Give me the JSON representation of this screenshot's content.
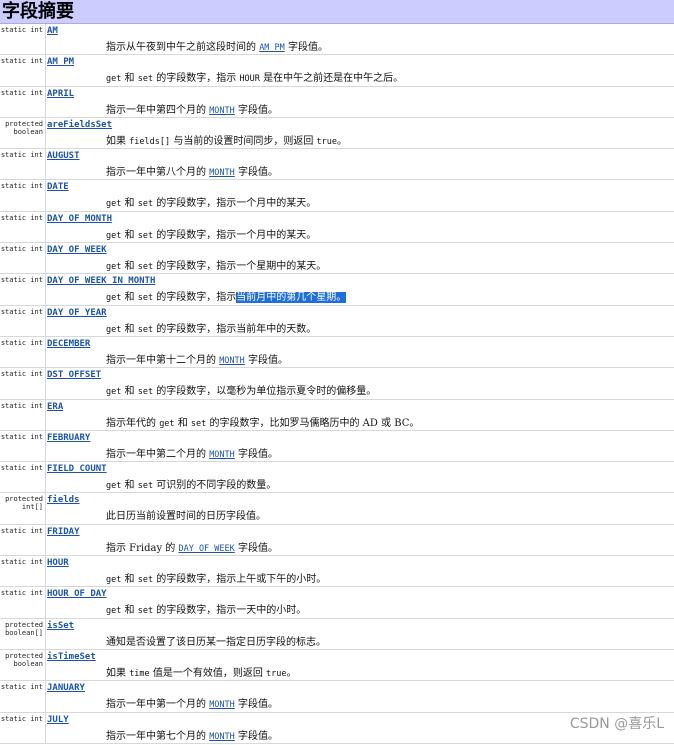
{
  "header": {
    "title": "字段摘要"
  },
  "rows": [
    {
      "modifier": "static int",
      "name": "AM",
      "parts": [
        {
          "t": "text",
          "v": "指示从午夜到中午之前这段时间的 "
        },
        {
          "t": "link",
          "v": "AM_PM"
        },
        {
          "t": "text",
          "v": " 字段值。"
        }
      ]
    },
    {
      "modifier": "static int",
      "name": "AM_PM",
      "parts": [
        {
          "t": "code",
          "v": "get"
        },
        {
          "t": "text",
          "v": " 和 "
        },
        {
          "t": "code",
          "v": "set"
        },
        {
          "t": "text",
          "v": " 的字段数字，指示 "
        },
        {
          "t": "code",
          "v": "HOUR"
        },
        {
          "t": "text",
          "v": " 是在中午之前还是在中午之后。"
        }
      ]
    },
    {
      "modifier": "static int",
      "name": "APRIL",
      "parts": [
        {
          "t": "text",
          "v": "指示一年中第四个月的 "
        },
        {
          "t": "link",
          "v": "MONTH"
        },
        {
          "t": "text",
          "v": " 字段值。"
        }
      ]
    },
    {
      "modifier": "protected\nboolean",
      "name": "areFieldsSet",
      "parts": [
        {
          "t": "text",
          "v": "如果 "
        },
        {
          "t": "code",
          "v": "fields[]"
        },
        {
          "t": "text",
          "v": " 与当前的设置时间同步，则返回 "
        },
        {
          "t": "code",
          "v": "true"
        },
        {
          "t": "text",
          "v": "。"
        }
      ]
    },
    {
      "modifier": "static int",
      "name": "AUGUST",
      "parts": [
        {
          "t": "text",
          "v": "指示一年中第八个月的 "
        },
        {
          "t": "link",
          "v": "MONTH"
        },
        {
          "t": "text",
          "v": " 字段值。"
        }
      ]
    },
    {
      "modifier": "static int",
      "name": "DATE",
      "parts": [
        {
          "t": "code",
          "v": "get"
        },
        {
          "t": "text",
          "v": " 和 "
        },
        {
          "t": "code",
          "v": "set"
        },
        {
          "t": "text",
          "v": " 的字段数字，指示一个月中的某天。"
        }
      ]
    },
    {
      "modifier": "static int",
      "name": "DAY_OF_MONTH",
      "parts": [
        {
          "t": "code",
          "v": "get"
        },
        {
          "t": "text",
          "v": " 和 "
        },
        {
          "t": "code",
          "v": "set"
        },
        {
          "t": "text",
          "v": " 的字段数字，指示一个月中的某天。"
        }
      ]
    },
    {
      "modifier": "static int",
      "name": "DAY_OF_WEEK",
      "parts": [
        {
          "t": "code",
          "v": "get"
        },
        {
          "t": "text",
          "v": " 和 "
        },
        {
          "t": "code",
          "v": "set"
        },
        {
          "t": "text",
          "v": " 的字段数字，指示一个星期中的某天。"
        }
      ]
    },
    {
      "modifier": "static int",
      "name": "DAY_OF_WEEK_IN_MONTH",
      "parts": [
        {
          "t": "code",
          "v": "get"
        },
        {
          "t": "text",
          "v": " 和 "
        },
        {
          "t": "code",
          "v": "set"
        },
        {
          "t": "text",
          "v": " 的字段数字，指示"
        },
        {
          "t": "hl",
          "v": "当前月中的第几个星期。"
        }
      ]
    },
    {
      "modifier": "static int",
      "name": "DAY_OF_YEAR",
      "parts": [
        {
          "t": "code",
          "v": "get"
        },
        {
          "t": "text",
          "v": " 和 "
        },
        {
          "t": "code",
          "v": "set"
        },
        {
          "t": "text",
          "v": " 的字段数字，指示当前年中的天数。"
        }
      ]
    },
    {
      "modifier": "static int",
      "name": "DECEMBER",
      "parts": [
        {
          "t": "text",
          "v": "指示一年中第十二个月的 "
        },
        {
          "t": "link",
          "v": "MONTH"
        },
        {
          "t": "text",
          "v": " 字段值。"
        }
      ]
    },
    {
      "modifier": "static int",
      "name": "DST_OFFSET",
      "parts": [
        {
          "t": "code",
          "v": "get"
        },
        {
          "t": "text",
          "v": " 和 "
        },
        {
          "t": "code",
          "v": "set"
        },
        {
          "t": "text",
          "v": " 的字段数字，以毫秒为单位指示夏令时的偏移量。"
        }
      ]
    },
    {
      "modifier": "static int",
      "name": "ERA",
      "parts": [
        {
          "t": "text",
          "v": "指示年代的 "
        },
        {
          "t": "code",
          "v": "get"
        },
        {
          "t": "text",
          "v": " 和 "
        },
        {
          "t": "code",
          "v": "set"
        },
        {
          "t": "text",
          "v": " 的字段数字，比如罗马儒略历中的 AD 或 BC。"
        }
      ]
    },
    {
      "modifier": "static int",
      "name": "FEBRUARY",
      "parts": [
        {
          "t": "text",
          "v": "指示一年中第二个月的 "
        },
        {
          "t": "link",
          "v": "MONTH"
        },
        {
          "t": "text",
          "v": " 字段值。"
        }
      ]
    },
    {
      "modifier": "static int",
      "name": "FIELD_COUNT",
      "parts": [
        {
          "t": "code",
          "v": "get"
        },
        {
          "t": "text",
          "v": " 和 "
        },
        {
          "t": "code",
          "v": "set"
        },
        {
          "t": "text",
          "v": " 可识别的不同字段的数量。"
        }
      ]
    },
    {
      "modifier": "protected\nint[]",
      "name": "fields",
      "parts": [
        {
          "t": "text",
          "v": "此日历当前设置时间的日历字段值。"
        }
      ]
    },
    {
      "modifier": "static int",
      "name": "FRIDAY",
      "parts": [
        {
          "t": "text",
          "v": "指示 Friday 的 "
        },
        {
          "t": "link",
          "v": "DAY_OF_WEEK"
        },
        {
          "t": "text",
          "v": " 字段值。"
        }
      ]
    },
    {
      "modifier": "static int",
      "name": "HOUR",
      "parts": [
        {
          "t": "code",
          "v": "get"
        },
        {
          "t": "text",
          "v": " 和 "
        },
        {
          "t": "code",
          "v": "set"
        },
        {
          "t": "text",
          "v": " 的字段数字，指示上午或下午的小时。"
        }
      ]
    },
    {
      "modifier": "static int",
      "name": "HOUR_OF_DAY",
      "parts": [
        {
          "t": "code",
          "v": "get"
        },
        {
          "t": "text",
          "v": " 和 "
        },
        {
          "t": "code",
          "v": "set"
        },
        {
          "t": "text",
          "v": " 的字段数字，指示一天中的小时。"
        }
      ]
    },
    {
      "modifier": "protected\nboolean[]",
      "name": "isSet",
      "parts": [
        {
          "t": "text",
          "v": "通知是否设置了该日历某一指定日历字段的标志。"
        }
      ]
    },
    {
      "modifier": "protected\nboolean",
      "name": "isTimeSet",
      "parts": [
        {
          "t": "text",
          "v": "如果 "
        },
        {
          "t": "code",
          "v": "time"
        },
        {
          "t": "text",
          "v": " 值是一个有效值，则返回 "
        },
        {
          "t": "code",
          "v": "true"
        },
        {
          "t": "text",
          "v": "。"
        }
      ]
    },
    {
      "modifier": "static int",
      "name": "JANUARY",
      "parts": [
        {
          "t": "text",
          "v": "指示一年中第一个月的 "
        },
        {
          "t": "link",
          "v": "MONTH"
        },
        {
          "t": "text",
          "v": " 字段值。"
        }
      ]
    },
    {
      "modifier": "static int",
      "name": "JULY",
      "parts": [
        {
          "t": "text",
          "v": "指示一年中第七个月的 "
        },
        {
          "t": "link",
          "v": "MONTH"
        },
        {
          "t": "text",
          "v": " 字段值。"
        }
      ]
    }
  ],
  "watermark": "CSDN @喜乐L"
}
